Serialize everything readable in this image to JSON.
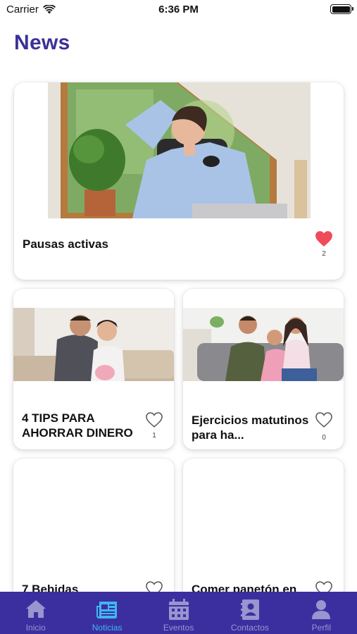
{
  "status_bar": {
    "carrier": "Carrier",
    "time": "6:36 PM"
  },
  "page": {
    "title": "News"
  },
  "featured": {
    "title": "Pausas activas",
    "likes": "2",
    "liked": true
  },
  "cards": [
    {
      "title": "4 TIPS PARA AHORRAR DINERO",
      "likes": "1",
      "liked": false
    },
    {
      "title": "Ejercicios matutinos para ha...",
      "likes": "0",
      "liked": false
    },
    {
      "title": "7 Bebidas",
      "likes": "",
      "liked": false
    },
    {
      "title": "Comer panetón en",
      "likes": "",
      "liked": false
    }
  ],
  "tabs": [
    {
      "label": "Inicio",
      "icon": "home-icon",
      "active": false
    },
    {
      "label": "Noticias",
      "icon": "newspaper-icon",
      "active": true
    },
    {
      "label": "Eventos",
      "icon": "calendar-icon",
      "active": false
    },
    {
      "label": "Contactos",
      "icon": "contacts-icon",
      "active": false
    },
    {
      "label": "Perfil",
      "icon": "person-icon",
      "active": false
    }
  ],
  "colors": {
    "accent": "#3b3199",
    "tab_bar": "#3b2fa0",
    "tab_active": "#3fb7f0",
    "heart_liked": "#ef4b5a"
  }
}
